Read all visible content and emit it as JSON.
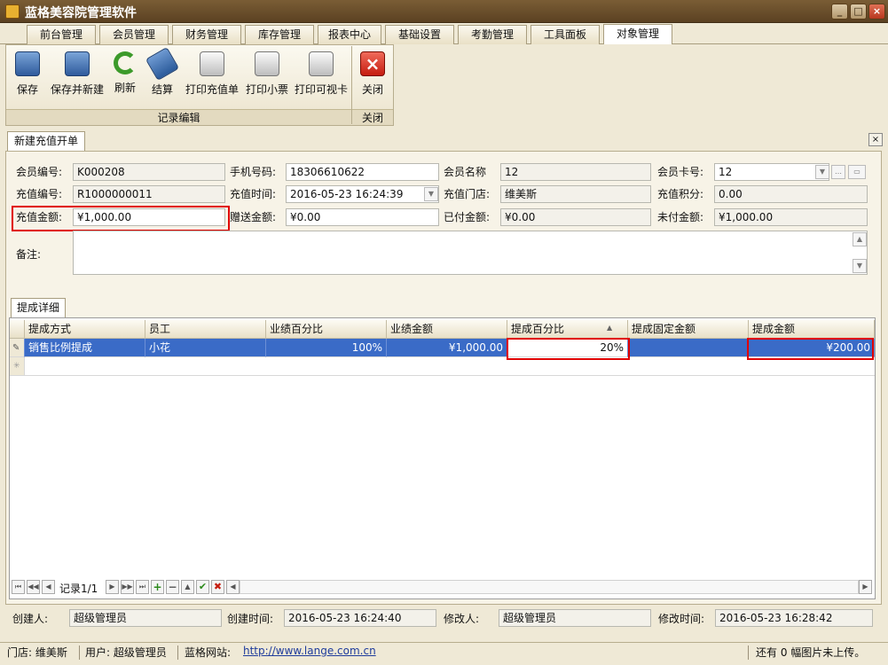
{
  "app": {
    "title": "蓝格美容院管理软件",
    "min": "_",
    "max": "□",
    "close": "×"
  },
  "tabs": [
    "前台管理",
    "会员管理",
    "财务管理",
    "库存管理",
    "报表中心",
    "基础设置",
    "考勤管理",
    "工具面板",
    "对象管理"
  ],
  "ribbon": {
    "buttons": [
      "保存",
      "保存并新建",
      "刷新",
      "结算",
      "打印充值单",
      "打印小票",
      "打印可视卡"
    ],
    "group_label": "记录编辑",
    "close_button": "关闭",
    "close_group_label": "关闭"
  },
  "doc_tab": "新建充值开单",
  "form": {
    "member_no_label": "会员编号:",
    "member_no": "K000208",
    "phone_label": "手机号码:",
    "phone": "18306610622",
    "member_name_label": "会员名称",
    "member_name": "12",
    "card_no_label": "会员卡号:",
    "card_no": "12",
    "recharge_no_label": "充值编号:",
    "recharge_no": "R1000000011",
    "recharge_time_label": "充值时间:",
    "recharge_time": "2016-05-23 16:24:39",
    "store_label": "充值门店:",
    "store": "维美斯",
    "points_label": "充值积分:",
    "points": "0.00",
    "amount_label": "充值金额:",
    "amount": "¥1,000.00",
    "gift_label": "赠送金额:",
    "gift": "¥0.00",
    "paid_label": "已付金额:",
    "paid": "¥0.00",
    "unpaid_label": "未付金额:",
    "unpaid": "¥1,000.00",
    "remark_label": "备注:"
  },
  "sub_tab": "提成详细",
  "grid": {
    "headers": [
      "提成方式",
      "员工",
      "业绩百分比",
      "业绩金额",
      "提成百分比",
      "提成固定金额",
      "提成金额"
    ],
    "row": [
      "销售比例提成",
      "小花",
      "100%",
      "¥1,000.00",
      "20%",
      "",
      "¥200.00"
    ]
  },
  "nav": {
    "record": "记录1/1"
  },
  "footer": {
    "creator_label": "创建人:",
    "creator": "超级管理员",
    "created_label": "创建时间:",
    "created": "2016-05-23 16:24:40",
    "modifier_label": "修改人:",
    "modifier": "超级管理员",
    "modified_label": "修改时间:",
    "modified": "2016-05-23 16:28:42"
  },
  "status": {
    "store": "门店: 维美斯",
    "user": "用户: 超级管理员",
    "site_label": "蓝格网站:",
    "site": "http://www.lange.com.cn",
    "upload": "还有 0 幅图片未上传。"
  },
  "colors": {
    "highlight": "#e00000",
    "selected_row": "#3a6bc7",
    "title_bg": "#6b4e2b"
  }
}
